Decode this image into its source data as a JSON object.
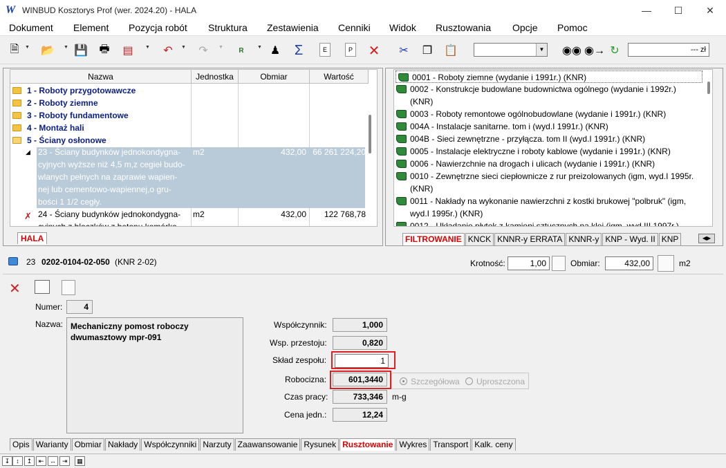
{
  "window": {
    "title": "WINBUD Kosztorys Prof (wer. 2024.20) - HALA",
    "logo_letter": "W"
  },
  "menu": [
    "Dokument",
    "Element",
    "Pozycja robót",
    "Struktura",
    "Zestawienia",
    "Cenniki",
    "Widok",
    "Rusztowania",
    "Opcje",
    "Pomoc"
  ],
  "toolbar": {
    "price_suffix": "--- zł",
    "combo_value": ""
  },
  "tree": {
    "columns": [
      "Nazwa",
      "Jednostka",
      "Obmiar",
      "Wartość"
    ],
    "folders": [
      "1 - Roboty przygotowawcze",
      "2 - Roboty ziemne",
      "3 - Roboty fundamentowe",
      "4 - Montaż hali",
      "5 - Ściany osłonowe"
    ],
    "selected": {
      "lines": [
        "23 - Ściany budynków jednokondygna-",
        "cyjnych wyższe niż 4,5 m,z cegieł budo-",
        "wlanych pełnych na zaprawie wapien-",
        "nej lub cementowo-wapiennej,o gru-",
        "bości 1 1/2 cegły."
      ],
      "unit": "m2",
      "obmiar": "432,00",
      "wartosc": "66 261 224,20"
    },
    "next": {
      "lines": [
        "24 - Ściany budynków jednokondygna-",
        "cyjnych z bloczków z betonu komórko-"
      ],
      "unit": "m2",
      "obmiar": "432,00",
      "wartosc": "122 768,78"
    },
    "tab": "HALA"
  },
  "catalog": {
    "rows": [
      "0001 - Roboty ziemne (wydanie i 1991r.) (KNR)",
      "0002 - Konstrukcje budowlane budownictwa ogólnego (wydanie i 1992r.)",
      "(KNR)",
      "0003 - Roboty remontowe ogólnobudowlane (wydanie i 1991r.) (KNR)",
      "004A - Instalacje sanitarne. tom i (wyd.I 1991r.) (KNR)",
      "004B - Sieci zewnętrzne - przyłącza. tom II (wyd.I 1991r.) (KNR)",
      "0005 - Instalacje elektryczne i roboty kablowe (wydanie i 1991r.) (KNR)",
      "0006 - Nawierzchnie na drogach i ulicach (wydanie i 1991r.) (KNR)",
      "0010 - Zewnętrzne sieci ciepłownicze z rur preizolowanych (igm, wyd.I 1995r.",
      "(KNR)",
      "0011 - Nakłady na wykonanie nawierzchni z kostki brukowej \"polbruk\" (igm,",
      "wyd.I 1995r.) (KNR)",
      "0012 - Układanie płytek z kamieni sztucznych na klej (igm, wyd.III 1997r.)"
    ],
    "tabs": [
      "FILTROWANIE",
      "KNCK",
      "KNNR-y ERRATA",
      "KNNR-y",
      "KNP - Wyd. II",
      "KNP"
    ]
  },
  "position": {
    "number": "23",
    "code": "0202-0104-02-050",
    "catalog": "(KNR 2-02)",
    "krotnosc_label": "Krotność:",
    "krotnosc": "1,00",
    "obmiar_label": "Obmiar:",
    "obmiar": "432,00",
    "unit": "m2"
  },
  "detail": {
    "numer_label": "Numer:",
    "numer": "4",
    "nazwa_label": "Nazwa:",
    "nazwa": "Mechaniczny pomost roboczy dwumasztowy mpr-091",
    "wspolczynnik_label": "Współczynnik:",
    "wspolczynnik": "1,000",
    "przestoj_label": "Wsp. przestoju:",
    "przestoj": "0,820",
    "sklad_label": "Skład zespołu:",
    "sklad": "1",
    "robocizna_label": "Robocizna:",
    "robocizna": "601,3440",
    "szczegolowa": "Szczegółowa",
    "uproszczona": "Uproszczona",
    "czas_label": "Czas pracy:",
    "czas": "733,346",
    "czas_unit": "m-g",
    "cena_label": "Cena jedn.:",
    "cena": "12,24"
  },
  "bottom_tabs": [
    "Opis",
    "Warianty",
    "Obmiar",
    "Nakłady",
    "Współczynniki",
    "Narzuty",
    "Zaawansowanie",
    "Rysunek",
    "Rusztowanie",
    "Wykres",
    "Transport",
    "Kalk. ceny"
  ],
  "active_bottom_tab": "Rusztowanie",
  "colors": {
    "accent_red": "#e02020",
    "tree_text": "#0a1e8a",
    "selection": "#b9cad8",
    "book_green": "#2f8a3a"
  }
}
